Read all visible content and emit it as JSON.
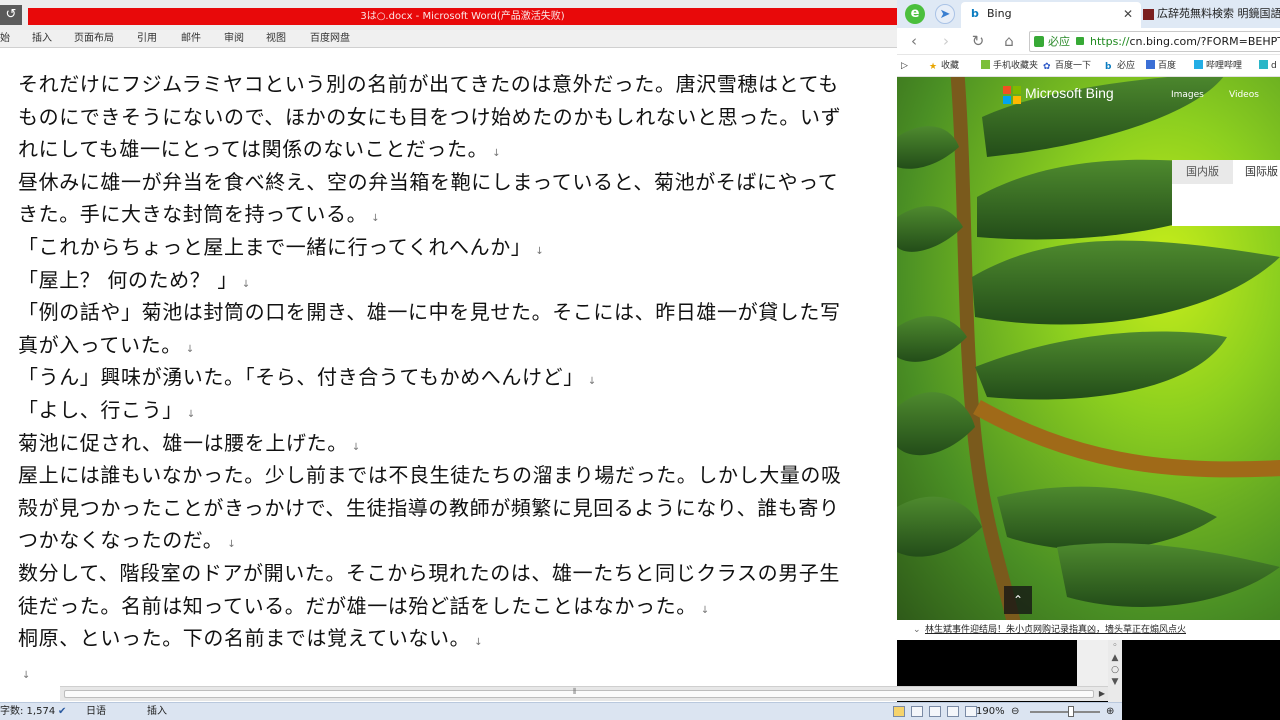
{
  "word": {
    "title": "3は○.docx - Microsoft Word(产品激活失败)",
    "ribbon_tabs": [
      "始",
      "插入",
      "页面布局",
      "引用",
      "邮件",
      "审阅",
      "视图",
      "百度网盘"
    ],
    "lines": [
      "それだけにフジムラミヤコという別の名前が出てきたのは意外だった。唐沢雪穂はとても",
      "ものにできそうにないので、ほかの女にも目をつけ始めたのかもしれないと思った。いず",
      "れにしても雄一にとっては関係のないことだった。↓",
      "昼休みに雄一が弁当を食べ終え、空の弁当箱を鞄にしまっていると、菊池がそばにやって",
      "きた。手に大きな封筒を持っている。↓",
      "「これからちょっと屋上まで一緒に行ってくれへんか」↓",
      "「屋上？ 何のため？ 」↓",
      "「例の話や」菊池は封筒の口を開き、雄一に中を見せた。そこには、昨日雄一が貸した写",
      "真が入っていた。↓",
      "「うん」興味が湧いた。「そら、付き合うてもかめへんけど」↓",
      "「よし、行こう」↓",
      "菊池に促され、雄一は腰を上げた。↓",
      "屋上には誰もいなかった。少し前までは不良生徒たちの溜まり場だった。しかし大量の吸",
      "殻が見つかったことがきっかけで、生徒指導の教師が頻繁に見回るようになり、誰も寄り",
      "つかなくなったのだ。↓",
      "数分して、階段室のドアが開いた。そこから現れたのは、雄一たちと同じクラスの男子生",
      "徒だった。名前は知っている。だが雄一は殆ど話をしたことはなかった。↓",
      "桐原、といった。下の名前までは覚えていない。↓",
      "↓"
    ],
    "status": {
      "word_count": "字数: 1,574",
      "language": "日语",
      "mode": "插入",
      "zoom": "190%"
    }
  },
  "browser": {
    "tab_active": "Bing",
    "tab_inactive": "広辞苑無料検索 明鏡国語辞典",
    "safe_badge": "必应",
    "url_scheme": "https://",
    "url_rest": "cn.bing.com/?FORM=BEHPTB",
    "bookmarks": [
      "收藏",
      "手机收藏夹",
      "百度一下",
      "必应",
      "百度",
      "哔哩哔哩",
      "d"
    ],
    "brand": "Microsoft Bing",
    "links": [
      "Images",
      "Videos"
    ],
    "region_tabs": [
      "国内版",
      "国际版"
    ],
    "news": "林生斌事件迎结局！朱小贞网购记录指真凶，墙头草正在煽风点火",
    "colors": {
      "accent_green": "#37a936",
      "title_red": "#e8090a",
      "bing_blue": "#0a7cc1"
    }
  }
}
